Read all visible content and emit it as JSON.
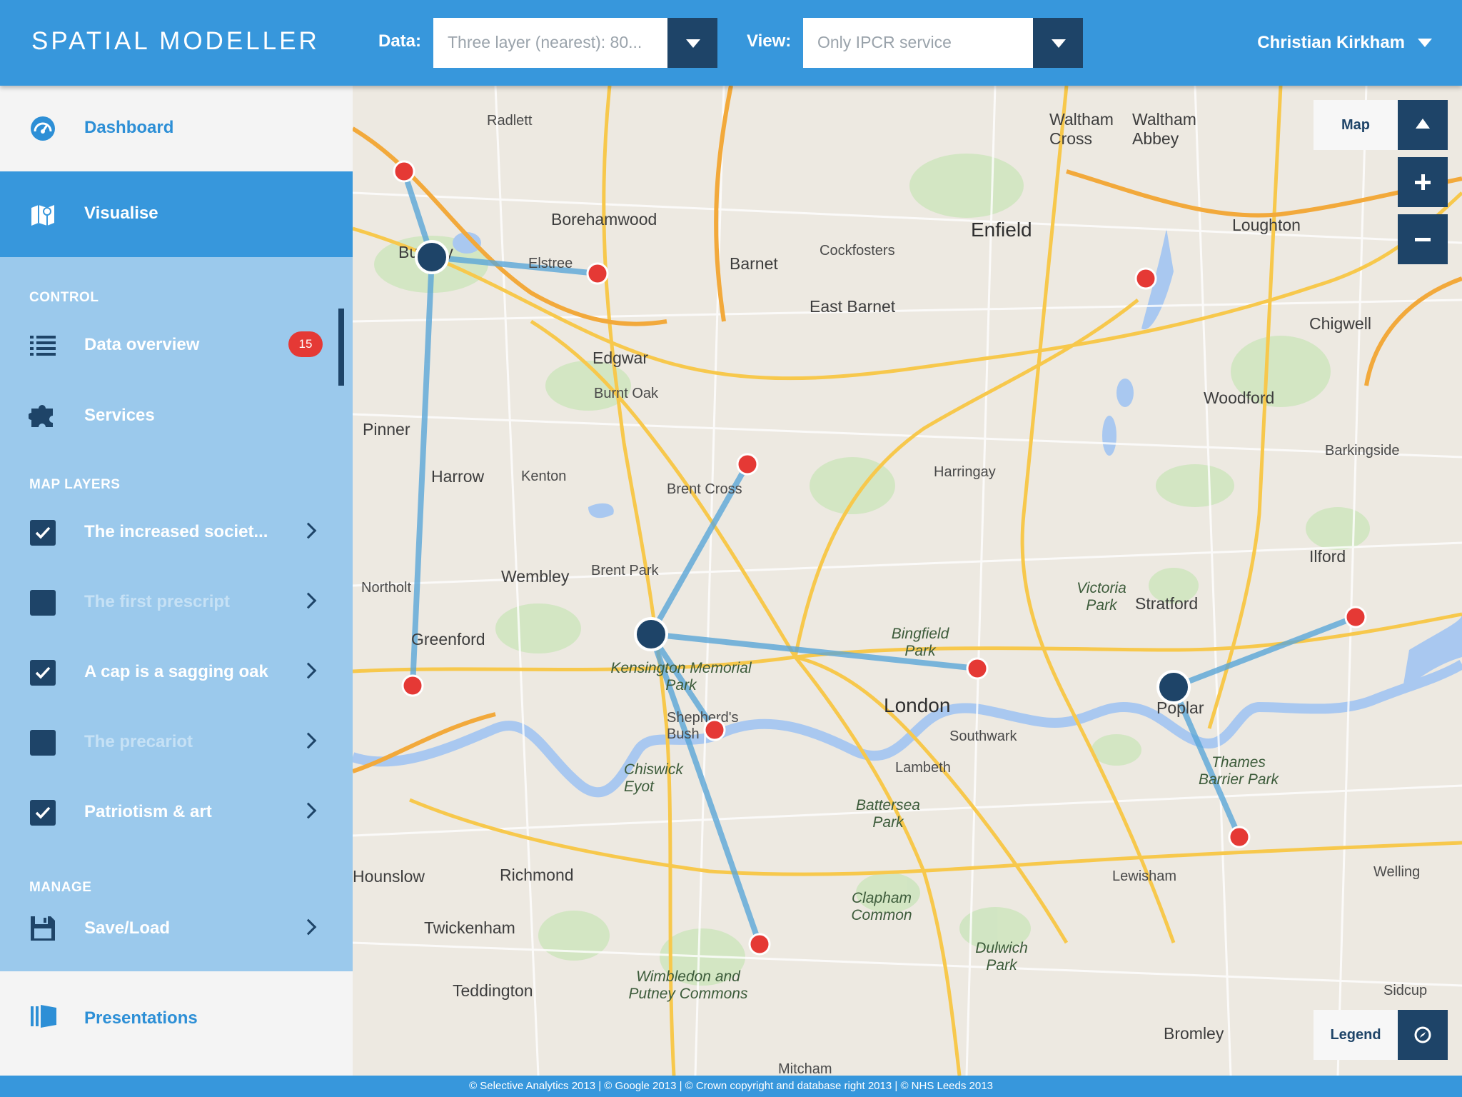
{
  "app": {
    "title": "SPATIAL MODELLER"
  },
  "header": {
    "data_label": "Data:",
    "data_value": "Three layer (nearest): 80...",
    "view_label": "View:",
    "view_value": "Only IPCR service",
    "user_name": "Christian Kirkham"
  },
  "sidebar": {
    "dashboard": "Dashboard",
    "visualise": "Visualise",
    "control_heading": "CONTROL",
    "data_overview": "Data overview",
    "data_overview_count": "15",
    "services": "Services",
    "map_layers_heading": "MAP LAYERS",
    "layers": [
      {
        "label": "The increased societ...",
        "checked": true
      },
      {
        "label": "The first prescript",
        "checked": false
      },
      {
        "label": "A cap is a sagging oak",
        "checked": true
      },
      {
        "label": "The precariot",
        "checked": false
      },
      {
        "label": "Patriotism & art",
        "checked": true
      }
    ],
    "manage_heading": "MANAGE",
    "save_load": "Save/Load",
    "presentations": "Presentations"
  },
  "map": {
    "type_label": "Map",
    "legend_label": "Legend",
    "place_labels": {
      "london": "London",
      "enfield": "Enfield",
      "barnet": "Barnet",
      "east_barnet": "East Barnet",
      "harrow": "Harrow",
      "wembley": "Wembley",
      "edgware": "Edgwar",
      "stratford": "Stratford",
      "richmond": "Richmond",
      "hounslow": "Hounslow",
      "twickenham": "Twickenham",
      "lewisham": "Lewisham",
      "bromley": "Bromley",
      "loughton": "Loughton",
      "chigwell": "Chigwell",
      "ilford": "Ilford",
      "woodford": "Woodford",
      "borehamwood": "Borehamwood",
      "southwark": "Southwark",
      "lambeth": "Lambeth",
      "teddington": "Teddington",
      "greenford": "Greenford",
      "bushey": "Bushey",
      "pinner": "Pinner",
      "radlett": "Radlett",
      "elstree": "Elstree",
      "waltham_abbey": "Waltham Abbey",
      "waltham_cross": "Waltham Cross",
      "brent_cross": "Brent Cross",
      "brent_park": "Brent Park",
      "kenton": "Kenton",
      "burnt_oak": "Burnt Oak",
      "harringay": "Harringay",
      "poplar": "Poplar",
      "shepherds_bush": "Shepherd's Bush",
      "welling": "Welling",
      "sidcup": "Sidcup",
      "barkingside": "Barkingside",
      "cockfosters": "Cockfosters",
      "chiswick": "Chiswick Eyot",
      "kensington": "Kensington Memorial Park",
      "battersea": "Battersea Park",
      "clapham": "Clapham Common",
      "dulwich": "Dulwich Park",
      "wimbledon": "Wimbledon and Putney Commons",
      "thames_barrier": "Thames Barrier Park",
      "victoria_park": "Victoria Park",
      "bingfield": "Bingfield Park",
      "mitcham": "Mitcham",
      "northolt": "Northolt"
    }
  },
  "footer": {
    "text": "© Selective Analytics 2013 | © Google 2013 | © Crown copyright and database right 2013 | © NHS Leeds 2013"
  },
  "colors": {
    "accent": "#3797dc",
    "dark": "#1e4468",
    "sidebar_bg": "#9bc9ec",
    "marker_red": "#e53935",
    "link_line": "#5aa6d8"
  }
}
